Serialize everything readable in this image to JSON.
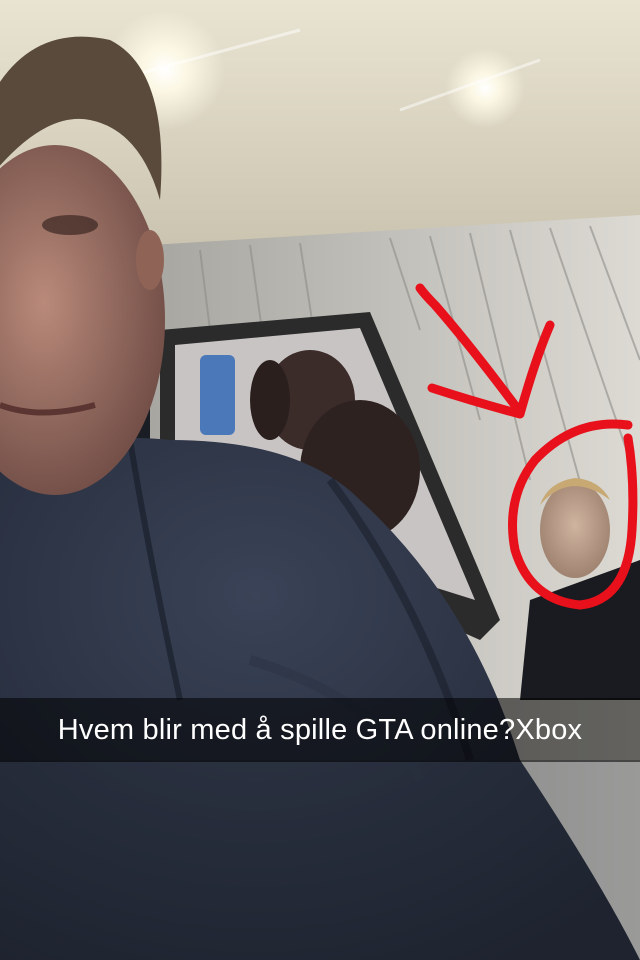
{
  "snap": {
    "caption": "Hvem blir med å spille GTA online?Xbox",
    "drawing_color": "#e8101a"
  }
}
